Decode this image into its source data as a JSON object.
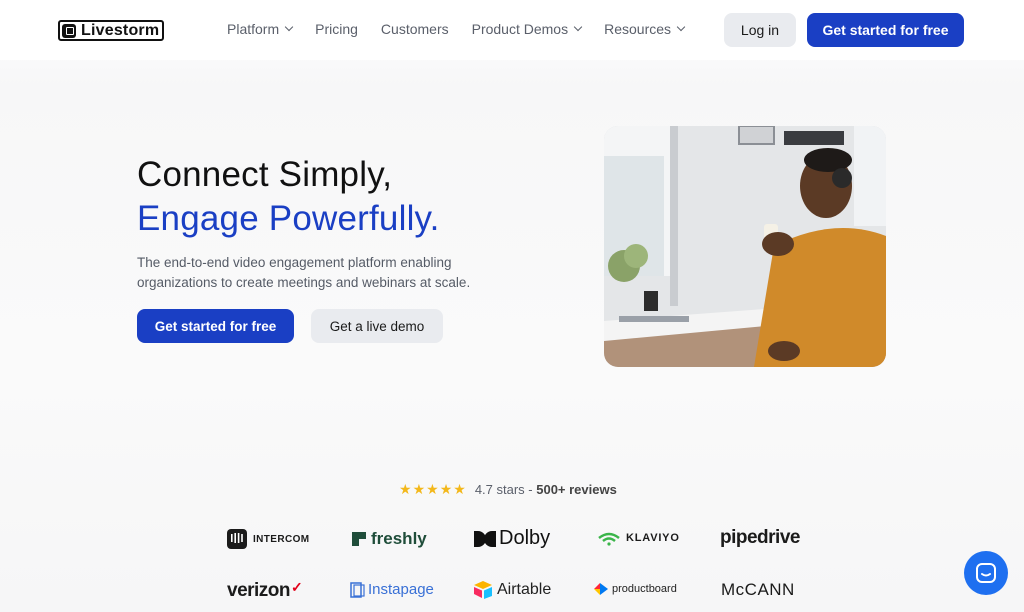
{
  "nav": {
    "logo_text": "Livestorm",
    "links": [
      {
        "label": "Platform",
        "dropdown": true
      },
      {
        "label": "Pricing",
        "dropdown": false
      },
      {
        "label": "Customers",
        "dropdown": false
      },
      {
        "label": "Product Demos",
        "dropdown": true
      },
      {
        "label": "Resources",
        "dropdown": true
      }
    ],
    "login_label": "Log in",
    "cta_label": "Get started for free"
  },
  "hero": {
    "title_line1": "Connect Simply,",
    "title_line2": "Engage Powerfully.",
    "subtitle": "The end-to-end video engagement platform enabling organizations to create meetings and webinars at scale.",
    "primary_cta": "Get started for free",
    "secondary_cta": "Get a live demo"
  },
  "reviews": {
    "rating_text": "4.7 stars - ",
    "count_text": "500+ reviews",
    "stars": 5
  },
  "logos": [
    "INTERCOM",
    "freshly",
    "Dolby",
    "KLAVIYO",
    "pipedrive",
    "verizon",
    "Instapage",
    "Airtable",
    "productboard",
    "McCANN"
  ],
  "colors": {
    "brand_blue": "#1a3fc4",
    "star_yellow": "#f3b81b",
    "chat_blue": "#1e6ff0"
  },
  "icons": [
    "chevron-down-icon",
    "star-icon",
    "chat-icon"
  ]
}
